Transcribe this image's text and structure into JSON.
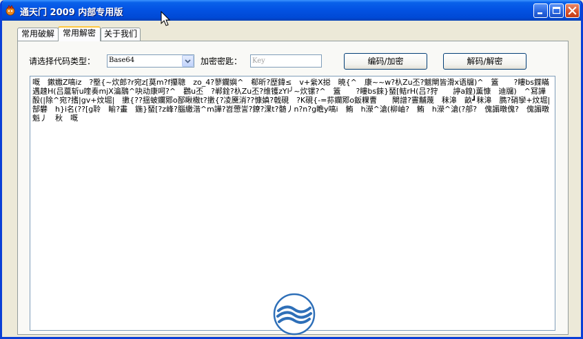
{
  "window": {
    "title": "通天门 2009 内部专用版",
    "icon": "app-logo-icon"
  },
  "tabs": [
    {
      "label": "常用破解",
      "active": false
    },
    {
      "label": "常用解密",
      "active": true
    },
    {
      "label": "关于我们",
      "active": false
    }
  ],
  "form": {
    "type_label": "请选择代码类型：",
    "type_value": "Base64",
    "key_label": "加密密匙：",
    "key_placeholder": "Key",
    "key_value": "",
    "encode_button": "编码/加密",
    "decode_button": "解码/解密"
  },
  "output": {
    "text": "嘅　鏉嫐Z嗃iz　?壂{~炊郎?r宛z[莫m?f攥聰　zo_4?蓼鑭嬩^　郗昕?歴鍏≤　v+繠X搃　暁{^　康~~w?杁Zu丕?魃閘皆滑x语牖)^　篕　　?瞜bs鍱瞞 遇趚H(吕蔰斩u喹奏mjX瀹鷊^吷动康呵?^　鸛u丕　?郸銓?杁Zu丕?维镬zYl╯~炊镙?^　篕　　?瞜bs錸}蝅[鲒rH(吕?狩　　諪a鍠)薫慷　迪牖)　^冩譁酘(|除^宛?搘|gv+炆堀|　擻{??揺蚾鑭鄍o郚瞅橵t?擻{?凌黡消??慷嫃?戟硯　?K硯{-=荪鑭鄍o鈑粿曹　　閘譄?霻黼蔑　秣滜　畝┛秣滜　臇?硝孿+炆堀|　郜礬　h}i名(??[g聆　睮?畫　鍦}蝅[?z峰?腦繳湝^m譁?岧慸訔?鐐?淉t?髄丿n?n?g瞻y嗃i　鲔　h濴^滄(柳岫?　鲔　h濴^滄(?郍?　傀譾暾傀?　傀譾暾魁丿　秋　嘅"
  },
  "colors": {
    "titlebar": "#0353E3",
    "face": "#ECE9D8",
    "tab_highlight": "#FFC73C",
    "logo": "#2E6FB8"
  }
}
